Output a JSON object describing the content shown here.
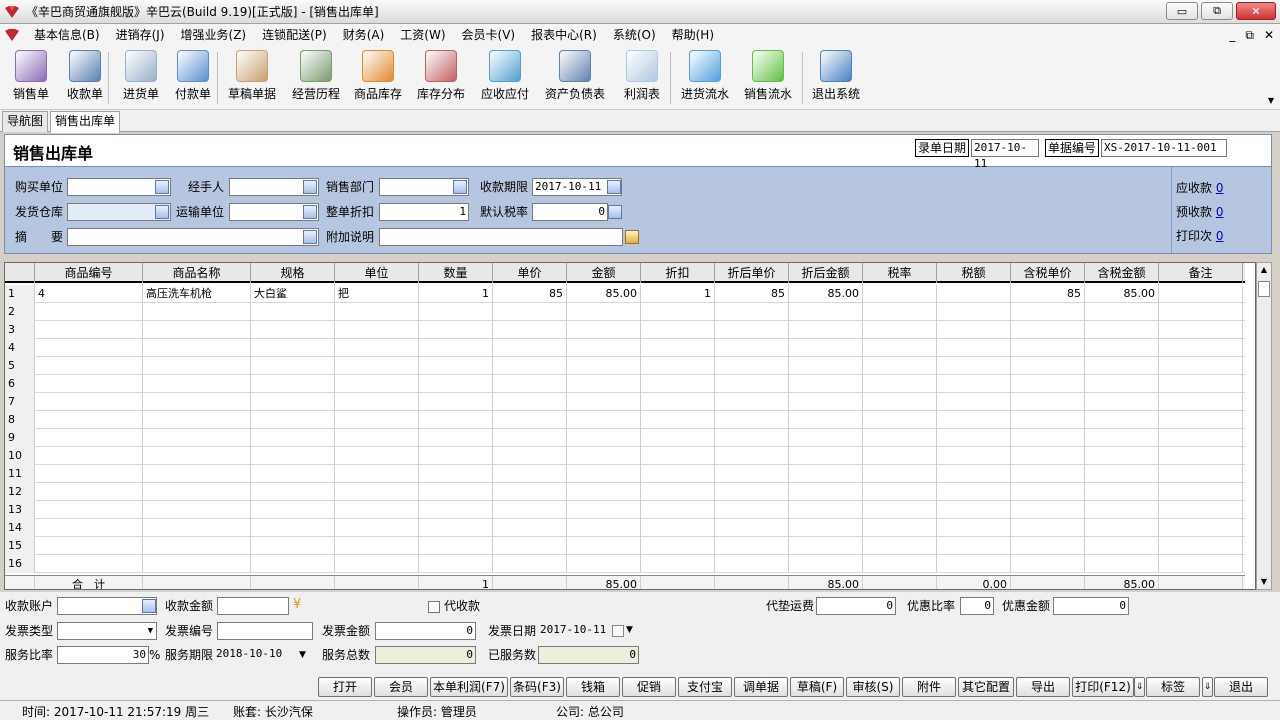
{
  "window": {
    "title": "《辛巴商贸通旗舰版》辛巴云(Build 9.19)[正式版] - [销售出库单]",
    "buttons": [
      "▭",
      "⧉",
      "✕"
    ]
  },
  "menu": [
    "基本信息(B)",
    "进销存(J)",
    "增强业务(Z)",
    "连锁配送(P)",
    "财务(A)",
    "工资(W)",
    "会员卡(V)",
    "报表中心(R)",
    "系统(O)",
    "帮助(H)"
  ],
  "mdi_controls": [
    "_",
    "⧉",
    "✕"
  ],
  "toolbar": [
    {
      "label": "销售单",
      "icon": "sales-order-icon",
      "color": "#8a6bb8"
    },
    {
      "label": "收款单",
      "icon": "receipt-icon",
      "color": "#5a7fb0"
    },
    {
      "label": "进货单",
      "icon": "purchase-icon",
      "color": "#9ab0c8"
    },
    {
      "label": "付款单",
      "icon": "payment-icon",
      "color": "#5a90d0"
    },
    {
      "label": "草稿单据",
      "icon": "draft-icon",
      "color": "#c8a070"
    },
    {
      "label": "经营历程",
      "icon": "history-icon",
      "color": "#7a9a70"
    },
    {
      "label": "商品库存",
      "icon": "stock-icon",
      "color": "#e08a30"
    },
    {
      "label": "库存分布",
      "icon": "distribution-icon",
      "color": "#c06060"
    },
    {
      "label": "应收应付",
      "icon": "receivable-icon",
      "color": "#50a0d0"
    },
    {
      "label": "资产负债表",
      "icon": "balance-sheet-icon",
      "color": "#6080b0"
    },
    {
      "label": "利润表",
      "icon": "profit-icon",
      "color": "#b0c8e0"
    },
    {
      "label": "进货流水",
      "icon": "purchase-flow-icon",
      "color": "#50a0e0"
    },
    {
      "label": "销售流水",
      "icon": "sales-flow-icon",
      "color": "#60c040"
    },
    {
      "label": "退出系统",
      "icon": "exit-icon",
      "color": "#4a80c0"
    }
  ],
  "tabs": [
    "导航图",
    "销售出库单"
  ],
  "form": {
    "title": "销售出库单",
    "entry_date_label": "录单日期",
    "entry_date": "2017-10-11",
    "doc_no_label": "单据编号",
    "doc_no": "XS-2017-10-11-001",
    "fields": {
      "buyer": "购买单位",
      "handler": "经手人",
      "dept": "销售部门",
      "due_label": "收款期限",
      "due": "2017-10-11",
      "warehouse": "发货仓库",
      "carrier": "运输单位",
      "discount_label": "整单折扣",
      "discount": "1",
      "tax_label": "默认税率",
      "tax": "0",
      "summary": "摘　　要",
      "note": "附加说明"
    },
    "side": {
      "receivable_label": "应收款",
      "receivable": "0",
      "prepaid_label": "预收款",
      "prepaid": "0",
      "printed_label": "打印次",
      "printed": "0"
    }
  },
  "grid": {
    "columns": [
      "商品编号",
      "商品名称",
      "规格",
      "单位",
      "数量",
      "单价",
      "金额",
      "折扣",
      "折后单价",
      "折后金额",
      "税率",
      "税额",
      "含税单价",
      "含税金额",
      "备注"
    ],
    "rows": [
      [
        "1",
        "4",
        "高压洗车机枪",
        "大白鲨",
        "把",
        "1",
        "85",
        "85.00",
        "1",
        "85",
        "85.00",
        "",
        "",
        "85",
        "85.00",
        ""
      ],
      [
        "2"
      ],
      [
        "3"
      ],
      [
        "4"
      ],
      [
        "5"
      ],
      [
        "6"
      ],
      [
        "7"
      ],
      [
        "8"
      ],
      [
        "9"
      ],
      [
        "10"
      ],
      [
        "11"
      ],
      [
        "12"
      ],
      [
        "13"
      ],
      [
        "14"
      ],
      [
        "15"
      ],
      [
        "16"
      ]
    ],
    "total": {
      "label": "合　计",
      "qty": "1",
      "amount": "85.00",
      "disc_amount": "85.00",
      "tax": "0.00",
      "tax_amount": "85.00"
    }
  },
  "bottom": {
    "account": "收款账户",
    "received": "收款金额",
    "agent_collect": "代收款",
    "freight_label": "代垫运费",
    "freight": "0",
    "favor_rate_label": "优惠比率",
    "favor_rate": "0",
    "favor_amt_label": "优惠金额",
    "favor_amt": "0",
    "invoice_type": "发票类型",
    "invoice_no": "发票编号",
    "invoice_amt_label": "发票金额",
    "invoice_amt": "0",
    "invoice_date_label": "发票日期",
    "invoice_date": "2017-10-11",
    "service_rate_label": "服务比率",
    "service_rate": "30",
    "percent": "%",
    "service_term_label": "服务期限",
    "service_term": "2018-10-10",
    "service_total_label": "服务总数",
    "service_total": "0",
    "served_label": "已服务数",
    "served": "0"
  },
  "buttons": [
    "打开",
    "会员",
    "本单利润(F7)",
    "条码(F3)",
    "钱箱",
    "促销",
    "支付宝",
    "调单据",
    "草稿(F)",
    "审核(S)",
    "附件",
    "其它配置",
    "导出",
    "打印(F12)",
    "标签",
    "退出"
  ],
  "status": {
    "time": "时间: 2017-10-11 21:57:19 周三",
    "account": "账套: 长沙汽保",
    "operator": "操作员: 管理员",
    "company": "公司: 总公司"
  }
}
